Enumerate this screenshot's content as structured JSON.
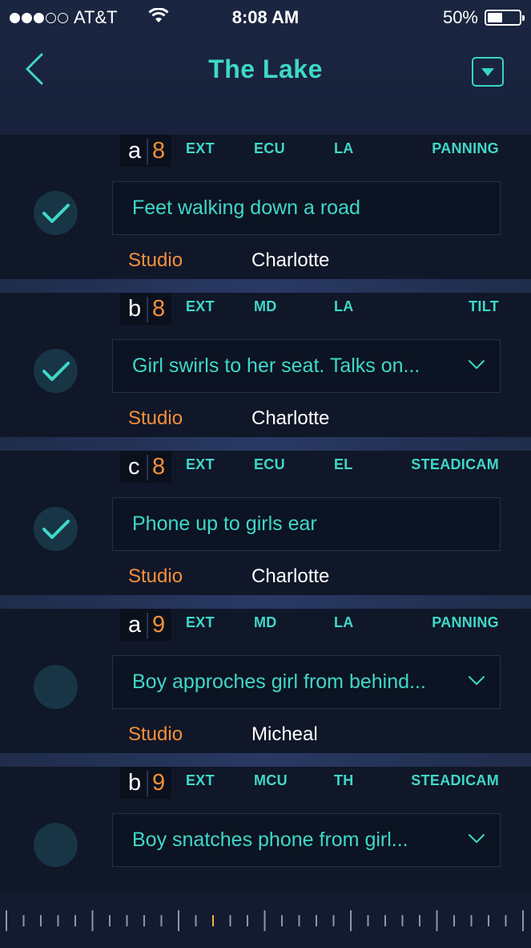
{
  "status_bar": {
    "carrier": "AT&T",
    "time": "8:08 AM",
    "battery_percent": "50%",
    "battery_level": 0.5,
    "signal_bars": 3
  },
  "nav": {
    "title": "The Lake"
  },
  "shots": [
    {
      "letter": "a",
      "scene": "8",
      "location_type": "EXT",
      "shot_size": "ECU",
      "angle": "LA",
      "movement": "PANNING",
      "description": "Feet walking down a road",
      "expandable": false,
      "completed": true,
      "set": "Studio",
      "character": "Charlotte"
    },
    {
      "letter": "b",
      "scene": "8",
      "location_type": "EXT",
      "shot_size": "MD",
      "angle": "LA",
      "movement": "TILT",
      "description": "Girl swirls to her seat. Talks on...",
      "expandable": true,
      "completed": true,
      "set": "Studio",
      "character": "Charlotte"
    },
    {
      "letter": "c",
      "scene": "8",
      "location_type": "EXT",
      "shot_size": "ECU",
      "angle": "EL",
      "movement": "STEADICAM",
      "description": "Phone up to girls ear",
      "expandable": false,
      "completed": true,
      "set": "Studio",
      "character": "Charlotte"
    },
    {
      "letter": "a",
      "scene": "9",
      "location_type": "EXT",
      "shot_size": "MD",
      "angle": "LA",
      "movement": "PANNING",
      "description": "Boy approches girl from behind...",
      "expandable": true,
      "completed": false,
      "set": "Studio",
      "character": "Micheal"
    },
    {
      "letter": "b",
      "scene": "9",
      "location_type": "EXT",
      "shot_size": "MCU",
      "angle": "TH",
      "movement": "STEADICAM",
      "description": "Boy snatches phone from girl...",
      "expandable": true,
      "completed": false,
      "set": "",
      "character": ""
    }
  ],
  "timeline": {
    "current_tick_index": 12,
    "tick_count": 30
  },
  "colors": {
    "accent": "#3fd8c8",
    "secondary": "#f6903b",
    "background": "#101728"
  }
}
